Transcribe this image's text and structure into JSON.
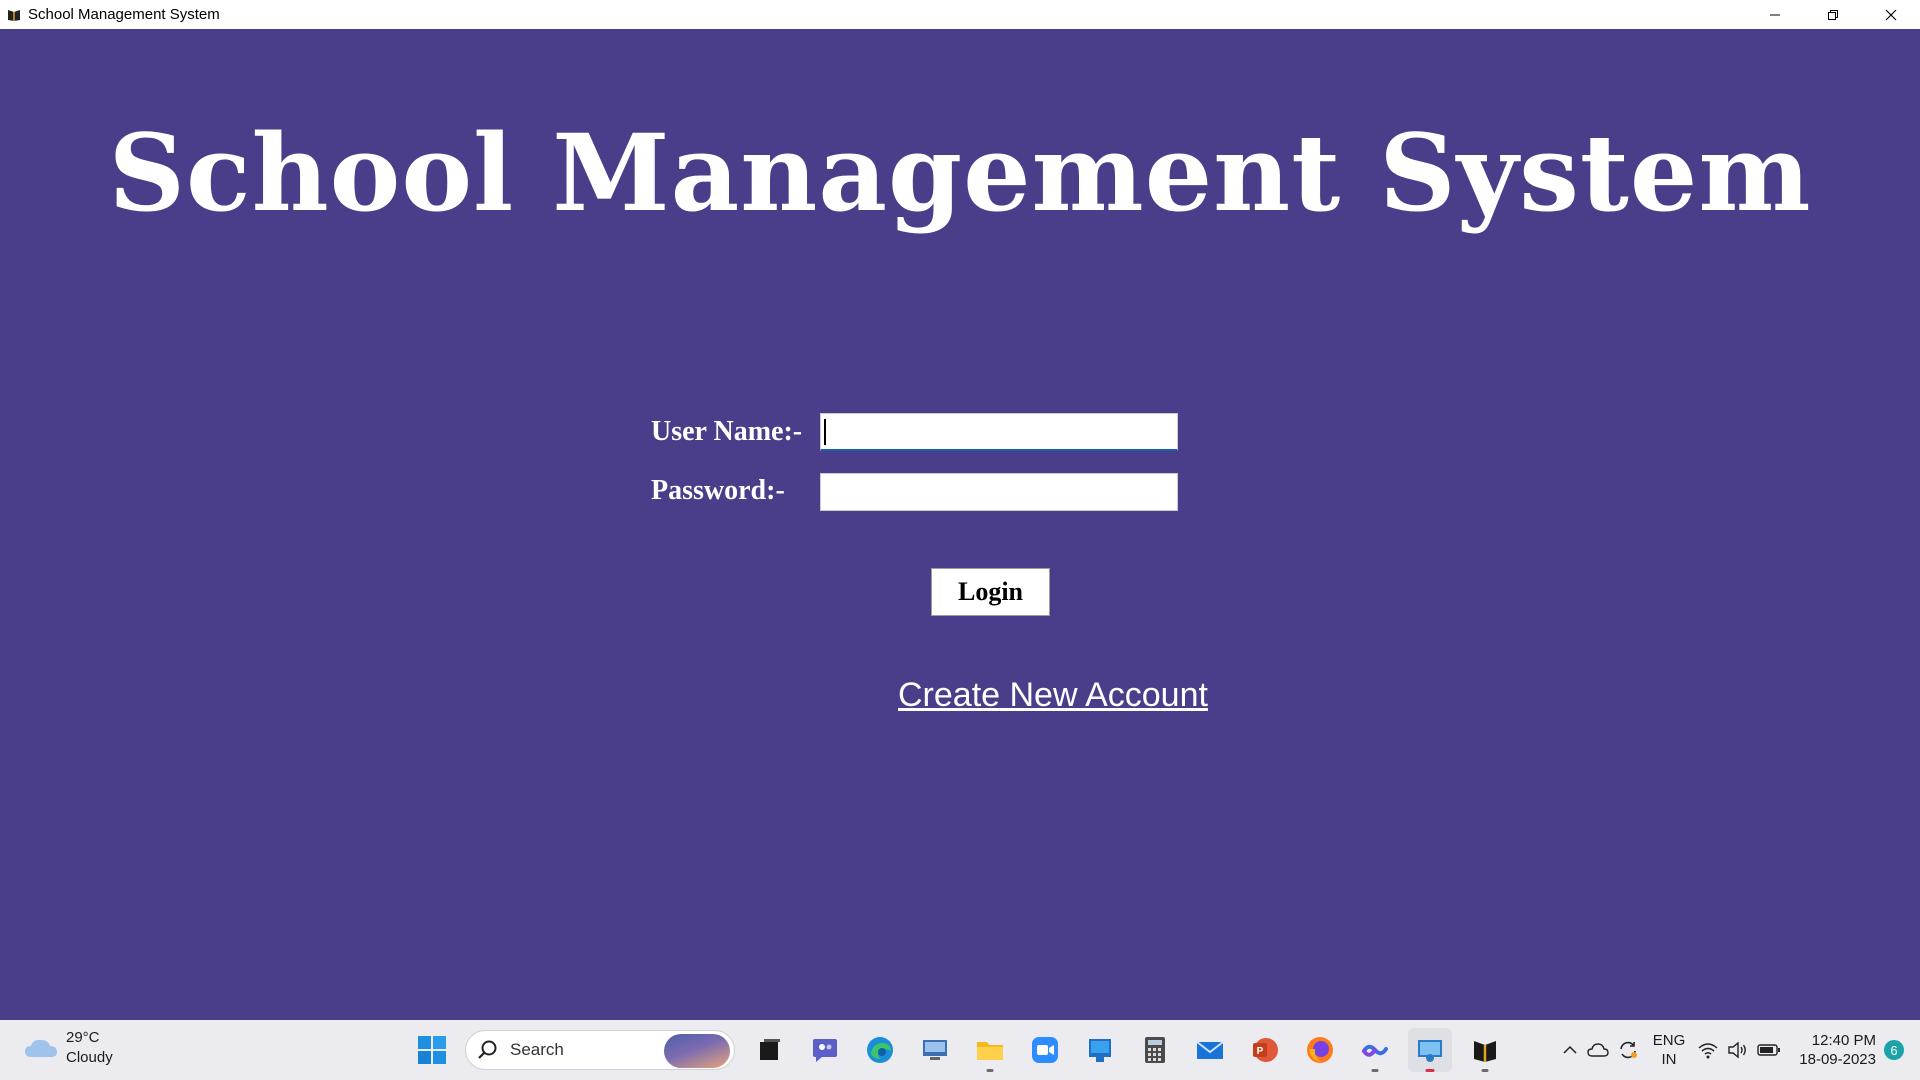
{
  "window": {
    "title": "School Management System"
  },
  "app": {
    "heading": "School Management System",
    "form": {
      "username_label": "User Name:-",
      "username_value": "",
      "password_label": "Password:-",
      "password_value": ""
    },
    "login_label": "Login",
    "create_account_label": "Create New Account"
  },
  "colors": {
    "background": "#4a3d8a",
    "text": "#ffffff",
    "taskbar": "#ecebf0"
  },
  "taskbar": {
    "weather": {
      "temp": "29°C",
      "condition": "Cloudy",
      "icon": "cloud-icon"
    },
    "search_placeholder": "Search",
    "pinned": [
      "windows-start-icon",
      "search-icon",
      "task-view-icon",
      "teams-icon",
      "edge-icon",
      "remote-desktop-icon",
      "file-explorer-icon",
      "zoom-icon",
      "store-icon",
      "calculator-icon",
      "mail-icon",
      "powerpoint-icon",
      "firefox-icon",
      "copilot-icon",
      "photos-icon",
      "school-app-icon"
    ],
    "tray": {
      "lang_line1": "ENG",
      "lang_line2": "IN",
      "time": "12:40 PM",
      "date": "18-09-2023",
      "notification_count": "6"
    }
  }
}
